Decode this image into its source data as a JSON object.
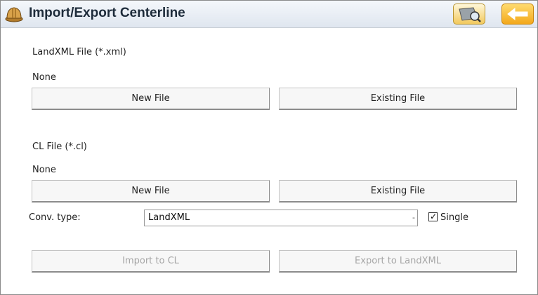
{
  "title": "Import/Export Centerline",
  "landxml": {
    "section_label": "LandXML File (*.xml)",
    "file_value": "None",
    "new_file_label": "New File",
    "existing_file_label": "Existing File"
  },
  "cl": {
    "section_label": "CL File (*.cl)",
    "file_value": "None",
    "new_file_label": "New File",
    "existing_file_label": "Existing File"
  },
  "conversion": {
    "label": "Conv. type:",
    "selected": "LandXML",
    "arrow": "-",
    "single_label": "Single",
    "single_checked": true
  },
  "actions": {
    "import_label": "Import to CL",
    "export_label": "Export to LandXML"
  },
  "icons": {
    "app": "hard-hat-icon",
    "map": "map-magnifier-icon",
    "back": "back-arrow-icon"
  },
  "colors": {
    "back_button": "#f3a81b",
    "title_bar": "#dfe6ef",
    "disabled_text": "#a6a6a6"
  }
}
